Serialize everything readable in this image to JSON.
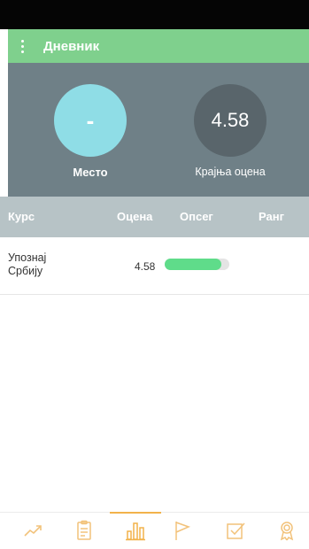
{
  "app": {
    "title": "Дневник"
  },
  "summary": {
    "place_value": "-",
    "place_label": "Место",
    "final_grade_value": "4.58",
    "final_grade_label": "Крајња оцена"
  },
  "table": {
    "headers": {
      "course": "Курс",
      "grade": "Оцена",
      "range": "Опсег",
      "rank": "Ранг"
    },
    "rows": [
      {
        "course": "Упознај Србију",
        "grade": "4.58",
        "range_fraction": 0.87,
        "rank": ""
      }
    ]
  },
  "bottom_nav": {
    "items": [
      "trend-icon",
      "notebook-icon",
      "bar-chart-icon",
      "flag-icon",
      "checkbox-icon",
      "award-icon"
    ],
    "active": "bar-chart-icon",
    "accent": "#f2b24a"
  },
  "colors": {
    "appbar": "#7fd08d",
    "summary_bg": "#6f8087",
    "place_circle": "#8fdde6",
    "grade_circle": "#59656b",
    "range_fill": "#5fdc8a"
  }
}
